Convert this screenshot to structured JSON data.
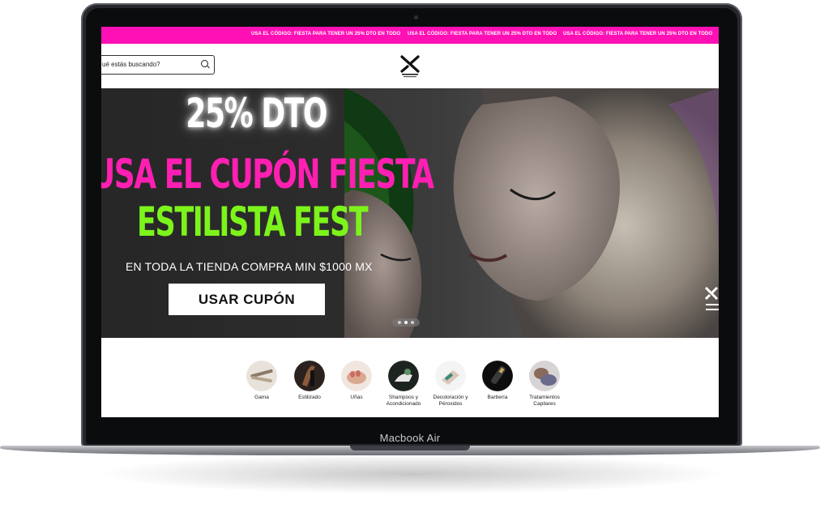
{
  "device": {
    "label": "Macbook Air"
  },
  "promo_bar": {
    "messages": [
      "USA EL CÓDIGO: FIESTA PARA TENER UN 25% DTO EN TODO",
      "USA EL CÓDIGO: FIESTA PARA TENER UN 25% DTO EN TODO",
      "USA EL CÓDIGO: FIESTA PARA TENER UN 25% DTO EN TODO"
    ],
    "color": "#ff10b5"
  },
  "header": {
    "search": {
      "value": "ué estás buscando?"
    }
  },
  "hero": {
    "discount": "25% DTO",
    "coupon_line": "USA EL CUPÓN FIESTA",
    "event": "ESTILISTA FEST",
    "subtitle": "EN TODA LA TIENDA  COMPRA MIN $1000 MX",
    "cta_label": "USAR CUPÓN",
    "accent_pink": "#ff1fb2",
    "accent_green": "#7cf41b",
    "slides_total": 3,
    "active_slide": 2
  },
  "categories": [
    {
      "label": "Gama",
      "icon": "tools-photo"
    },
    {
      "label": "Estilizado",
      "icon": "hair-straightener-photo"
    },
    {
      "label": "Uñas",
      "icon": "nails-photo"
    },
    {
      "label": "Shampoos y Acondicionado",
      "icon": "shampoo-photo"
    },
    {
      "label": "Decoloración y Péroxidos",
      "icon": "bleach-photo"
    },
    {
      "label": "Barbería",
      "icon": "clipper-photo"
    },
    {
      "label": "Tratamientos Capilares",
      "icon": "treatment-photo"
    }
  ]
}
